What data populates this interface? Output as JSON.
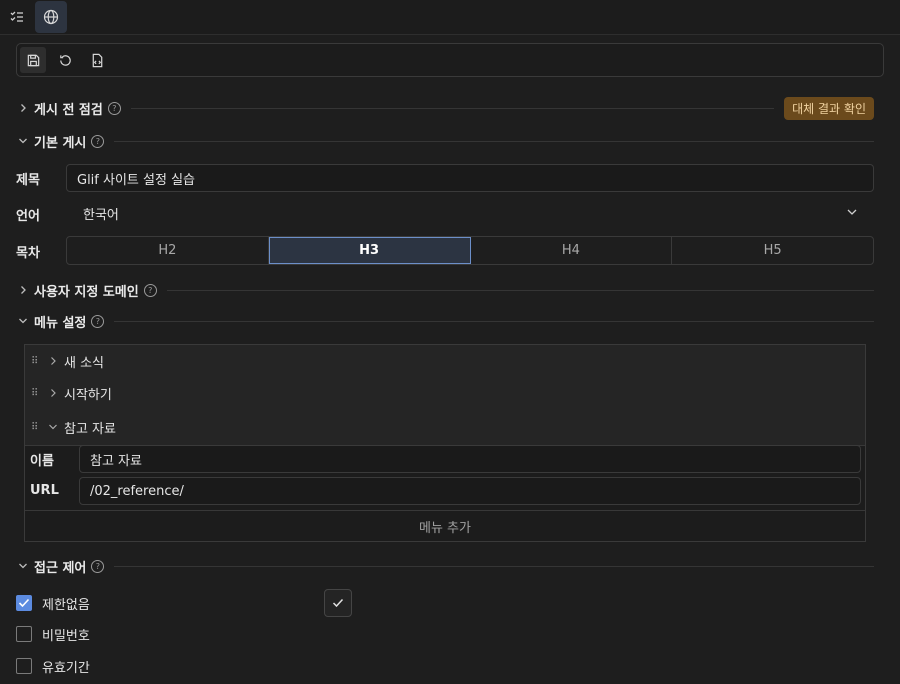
{
  "topbar": {
    "tabs": [
      {
        "icon": "checklist-icon"
      },
      {
        "icon": "globe-icon"
      }
    ]
  },
  "toolbar": {
    "tools": [
      {
        "icon": "save-icon"
      },
      {
        "icon": "refresh-icon"
      },
      {
        "icon": "code-file-icon"
      }
    ]
  },
  "sections": {
    "precheck": {
      "title": "게시 전 점검",
      "badge": "대체 결과 확인"
    },
    "basic": {
      "title": "기본 게시"
    },
    "domain": {
      "title": "사용자 지정 도메인"
    },
    "menu": {
      "title": "메뉴 설정"
    },
    "access": {
      "title": "접근 제어"
    }
  },
  "help_glyph": "?",
  "basic": {
    "title_label": "제목",
    "title_value": "Glif 사이트 설정 실습",
    "language_label": "언어",
    "language_value": "한국어",
    "toc_label": "목차",
    "toc_options": [
      "H2",
      "H3",
      "H4",
      "H5"
    ],
    "toc_selected": "H3"
  },
  "menu": {
    "grip": "⠿",
    "items": [
      {
        "label": "새 소식",
        "expanded": false
      },
      {
        "label": "시작하기",
        "expanded": false
      },
      {
        "label": "참고 자료",
        "expanded": true
      }
    ],
    "detail": {
      "name_label": "이름",
      "name_value": "참고 자료",
      "url_label": "URL",
      "url_value": "/02_reference/"
    },
    "add_label": "메뉴 추가"
  },
  "access": {
    "options": [
      {
        "label": "제한없음",
        "checked": true
      },
      {
        "label": "비밀번호",
        "checked": false
      },
      {
        "label": "유효기간",
        "checked": false
      }
    ]
  },
  "colors": {
    "background": "#1e1e1e",
    "accent": "#5c8be0",
    "badge_bg": "#6b4a1c",
    "badge_text": "#f0d2a0"
  }
}
